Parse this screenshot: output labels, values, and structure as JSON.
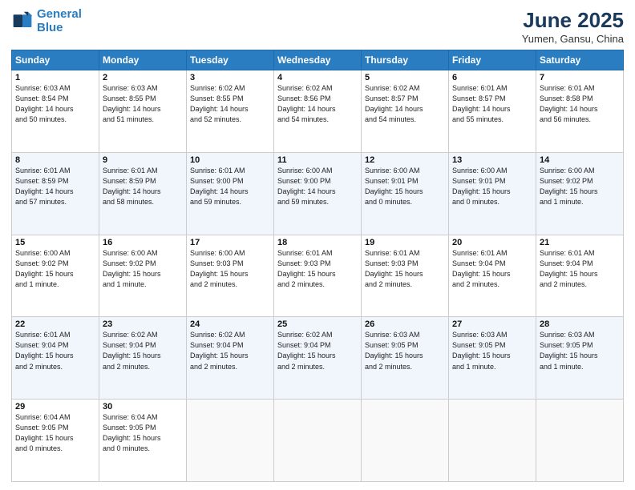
{
  "header": {
    "logo_line1": "General",
    "logo_line2": "Blue",
    "title": "June 2025",
    "subtitle": "Yumen, Gansu, China"
  },
  "weekdays": [
    "Sunday",
    "Monday",
    "Tuesday",
    "Wednesday",
    "Thursday",
    "Friday",
    "Saturday"
  ],
  "weeks": [
    [
      {
        "day": "1",
        "info": "Sunrise: 6:03 AM\nSunset: 8:54 PM\nDaylight: 14 hours\nand 50 minutes."
      },
      {
        "day": "2",
        "info": "Sunrise: 6:03 AM\nSunset: 8:55 PM\nDaylight: 14 hours\nand 51 minutes."
      },
      {
        "day": "3",
        "info": "Sunrise: 6:02 AM\nSunset: 8:55 PM\nDaylight: 14 hours\nand 52 minutes."
      },
      {
        "day": "4",
        "info": "Sunrise: 6:02 AM\nSunset: 8:56 PM\nDaylight: 14 hours\nand 54 minutes."
      },
      {
        "day": "5",
        "info": "Sunrise: 6:02 AM\nSunset: 8:57 PM\nDaylight: 14 hours\nand 54 minutes."
      },
      {
        "day": "6",
        "info": "Sunrise: 6:01 AM\nSunset: 8:57 PM\nDaylight: 14 hours\nand 55 minutes."
      },
      {
        "day": "7",
        "info": "Sunrise: 6:01 AM\nSunset: 8:58 PM\nDaylight: 14 hours\nand 56 minutes."
      }
    ],
    [
      {
        "day": "8",
        "info": "Sunrise: 6:01 AM\nSunset: 8:59 PM\nDaylight: 14 hours\nand 57 minutes."
      },
      {
        "day": "9",
        "info": "Sunrise: 6:01 AM\nSunset: 8:59 PM\nDaylight: 14 hours\nand 58 minutes."
      },
      {
        "day": "10",
        "info": "Sunrise: 6:01 AM\nSunset: 9:00 PM\nDaylight: 14 hours\nand 59 minutes."
      },
      {
        "day": "11",
        "info": "Sunrise: 6:00 AM\nSunset: 9:00 PM\nDaylight: 14 hours\nand 59 minutes."
      },
      {
        "day": "12",
        "info": "Sunrise: 6:00 AM\nSunset: 9:01 PM\nDaylight: 15 hours\nand 0 minutes."
      },
      {
        "day": "13",
        "info": "Sunrise: 6:00 AM\nSunset: 9:01 PM\nDaylight: 15 hours\nand 0 minutes."
      },
      {
        "day": "14",
        "info": "Sunrise: 6:00 AM\nSunset: 9:02 PM\nDaylight: 15 hours\nand 1 minute."
      }
    ],
    [
      {
        "day": "15",
        "info": "Sunrise: 6:00 AM\nSunset: 9:02 PM\nDaylight: 15 hours\nand 1 minute."
      },
      {
        "day": "16",
        "info": "Sunrise: 6:00 AM\nSunset: 9:02 PM\nDaylight: 15 hours\nand 1 minute."
      },
      {
        "day": "17",
        "info": "Sunrise: 6:00 AM\nSunset: 9:03 PM\nDaylight: 15 hours\nand 2 minutes."
      },
      {
        "day": "18",
        "info": "Sunrise: 6:01 AM\nSunset: 9:03 PM\nDaylight: 15 hours\nand 2 minutes."
      },
      {
        "day": "19",
        "info": "Sunrise: 6:01 AM\nSunset: 9:03 PM\nDaylight: 15 hours\nand 2 minutes."
      },
      {
        "day": "20",
        "info": "Sunrise: 6:01 AM\nSunset: 9:04 PM\nDaylight: 15 hours\nand 2 minutes."
      },
      {
        "day": "21",
        "info": "Sunrise: 6:01 AM\nSunset: 9:04 PM\nDaylight: 15 hours\nand 2 minutes."
      }
    ],
    [
      {
        "day": "22",
        "info": "Sunrise: 6:01 AM\nSunset: 9:04 PM\nDaylight: 15 hours\nand 2 minutes."
      },
      {
        "day": "23",
        "info": "Sunrise: 6:02 AM\nSunset: 9:04 PM\nDaylight: 15 hours\nand 2 minutes."
      },
      {
        "day": "24",
        "info": "Sunrise: 6:02 AM\nSunset: 9:04 PM\nDaylight: 15 hours\nand 2 minutes."
      },
      {
        "day": "25",
        "info": "Sunrise: 6:02 AM\nSunset: 9:04 PM\nDaylight: 15 hours\nand 2 minutes."
      },
      {
        "day": "26",
        "info": "Sunrise: 6:03 AM\nSunset: 9:05 PM\nDaylight: 15 hours\nand 2 minutes."
      },
      {
        "day": "27",
        "info": "Sunrise: 6:03 AM\nSunset: 9:05 PM\nDaylight: 15 hours\nand 1 minute."
      },
      {
        "day": "28",
        "info": "Sunrise: 6:03 AM\nSunset: 9:05 PM\nDaylight: 15 hours\nand 1 minute."
      }
    ],
    [
      {
        "day": "29",
        "info": "Sunrise: 6:04 AM\nSunset: 9:05 PM\nDaylight: 15 hours\nand 0 minutes."
      },
      {
        "day": "30",
        "info": "Sunrise: 6:04 AM\nSunset: 9:05 PM\nDaylight: 15 hours\nand 0 minutes."
      },
      {
        "day": "",
        "info": ""
      },
      {
        "day": "",
        "info": ""
      },
      {
        "day": "",
        "info": ""
      },
      {
        "day": "",
        "info": ""
      },
      {
        "day": "",
        "info": ""
      }
    ]
  ]
}
